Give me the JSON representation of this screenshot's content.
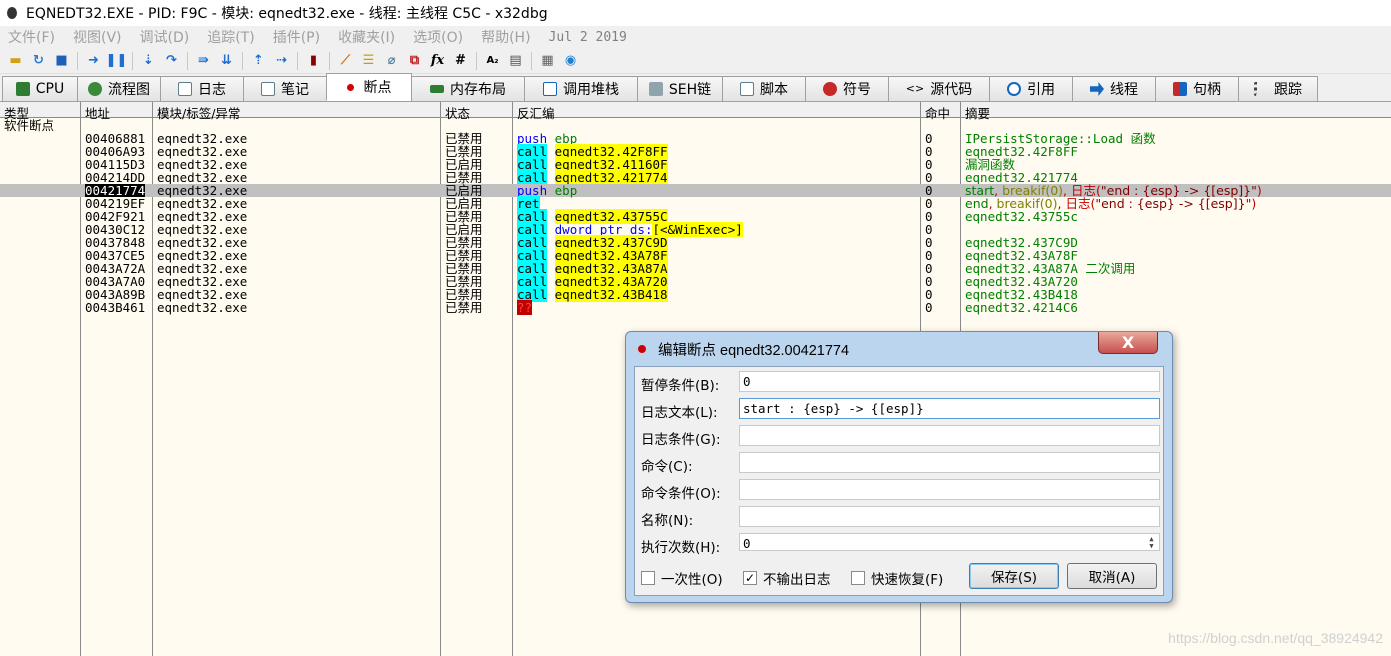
{
  "window": {
    "title": "EQNEDT32.EXE - PID: F9C - 模块: eqnedt32.exe - 线程: 主线程 C5C - x32dbg"
  },
  "menu": {
    "items": [
      "文件(F)",
      "视图(V)",
      "调试(D)",
      "追踪(T)",
      "插件(P)",
      "收藏夹(I)",
      "选项(O)",
      "帮助(H)"
    ],
    "date": "Jul 2 2019"
  },
  "toolbar": {
    "icons": [
      "open-icon",
      "restart-icon",
      "stop-icon",
      "run-icon",
      "pause-icon",
      "step-into-icon",
      "step-over-icon",
      "trace-into-icon",
      "trace-over-icon",
      "execute-till-return-icon",
      "run-to-user-code-icon",
      "script-icon",
      "patch-icon",
      "comment-icon",
      "label-icon",
      "bookmark-icon",
      "function-icon",
      "hash-icon",
      "font-icon",
      "calculator-icon",
      "globe-icon"
    ],
    "glyphs": {
      "function": "fx",
      "hash": "#",
      "font": "A₂"
    }
  },
  "tabs": [
    {
      "label": "CPU",
      "icon": "cpu-icon",
      "color": "#2e7d32"
    },
    {
      "label": "流程图",
      "icon": "graph-icon",
      "color": "#3a8a3a"
    },
    {
      "label": "日志",
      "icon": "log-icon",
      "color": "#607d8b"
    },
    {
      "label": "笔记",
      "icon": "notes-icon",
      "color": "#607d8b"
    },
    {
      "label": "断点",
      "icon": "breakpoint-icon",
      "color": "#d50000"
    },
    {
      "label": "内存布局",
      "icon": "memory-icon",
      "color": "#2e7d32"
    },
    {
      "label": "调用堆栈",
      "icon": "callstack-icon",
      "color": "#1565c0"
    },
    {
      "label": "SEH链",
      "icon": "seh-icon",
      "color": "#455a64"
    },
    {
      "label": "脚本",
      "icon": "script-icon",
      "color": "#607d8b"
    },
    {
      "label": "符号",
      "icon": "symbols-icon",
      "color": "#c62828"
    },
    {
      "label": "源代码",
      "icon": "source-icon",
      "color": "#424242"
    },
    {
      "label": "引用",
      "icon": "references-icon",
      "color": "#1565c0"
    },
    {
      "label": "线程",
      "icon": "threads-icon",
      "color": "#1565c0"
    },
    {
      "label": "句柄",
      "icon": "handles-icon",
      "color": "#c62828"
    },
    {
      "label": "跟踪",
      "icon": "trace-icon",
      "color": "#424242"
    }
  ],
  "active_tab": "断点",
  "columns": {
    "type": "类型",
    "address": "地址",
    "module": "模块/标签/异常",
    "state": "状态",
    "disasm": "反汇编",
    "hits": "命中",
    "summary": "摘要"
  },
  "group_label": "软件断点",
  "rows": [
    {
      "address": "00406881",
      "module": "eqnedt32.exe",
      "state": "已禁用",
      "disasm": [
        "push",
        "ebp",
        ""
      ],
      "hits": "0",
      "summary": "IPersistStorage::Load 函数"
    },
    {
      "address": "00406A93",
      "module": "eqnedt32.exe",
      "state": "已禁用",
      "disasm": [
        "call",
        "eqnedt32.42F8FF",
        ""
      ],
      "hits": "0",
      "summary": "eqnedt32.42F8FF"
    },
    {
      "address": "004115D3",
      "module": "eqnedt32.exe",
      "state": "已启用",
      "disasm": [
        "call",
        "eqnedt32.41160F",
        ""
      ],
      "hits": "0",
      "summary": "漏洞函数"
    },
    {
      "address": "004214DD",
      "module": "eqnedt32.exe",
      "state": "已禁用",
      "disasm": [
        "call",
        "eqnedt32.421774",
        ""
      ],
      "hits": "0",
      "summary": "eqnedt32.421774"
    },
    {
      "address": "00421774",
      "module": "eqnedt32.exe",
      "state": "已启用",
      "disasm": [
        "push",
        "ebp",
        ""
      ],
      "hits": "0",
      "summary": "start, breakif(0), 日志(\"end : {esp} -> {[esp]}\")"
    },
    {
      "address": "004219EF",
      "module": "eqnedt32.exe",
      "state": "已启用",
      "disasm": [
        "ret",
        "",
        ""
      ],
      "hits": "0",
      "summary": "end, breakif(0), 日志(\"end : {esp} -> {[esp]}\")"
    },
    {
      "address": "0042F921",
      "module": "eqnedt32.exe",
      "state": "已禁用",
      "disasm": [
        "call",
        "eqnedt32.43755C",
        ""
      ],
      "hits": "0",
      "summary": "eqnedt32.43755c"
    },
    {
      "address": "00430C12",
      "module": "eqnedt32.exe",
      "state": "已启用",
      "disasm": [
        "call",
        "dword ptr ds:",
        "[<&WinExec>]"
      ],
      "hits": "0",
      "summary": ""
    },
    {
      "address": "00437848",
      "module": "eqnedt32.exe",
      "state": "已禁用",
      "disasm": [
        "call",
        "eqnedt32.437C9D",
        ""
      ],
      "hits": "0",
      "summary": "eqnedt32.437C9D"
    },
    {
      "address": "00437CE5",
      "module": "eqnedt32.exe",
      "state": "已禁用",
      "disasm": [
        "call",
        "eqnedt32.43A78F",
        ""
      ],
      "hits": "0",
      "summary": "eqnedt32.43A78F"
    },
    {
      "address": "0043A72A",
      "module": "eqnedt32.exe",
      "state": "已禁用",
      "disasm": [
        "call",
        "eqnedt32.43A87A",
        ""
      ],
      "hits": "0",
      "summary": "eqnedt32.43A87A 二次调用"
    },
    {
      "address": "0043A7A0",
      "module": "eqnedt32.exe",
      "state": "已禁用",
      "disasm": [
        "call",
        "eqnedt32.43A720",
        ""
      ],
      "hits": "0",
      "summary": "eqnedt32.43A720"
    },
    {
      "address": "0043A89B",
      "module": "eqnedt32.exe",
      "state": "已禁用",
      "disasm": [
        "call",
        "eqnedt32.43B418",
        ""
      ],
      "hits": "0",
      "summary": "eqnedt32.43B418"
    },
    {
      "address": "0043B461",
      "module": "eqnedt32.exe",
      "state": "已禁用",
      "disasm": [
        "??",
        "",
        ""
      ],
      "hits": "0",
      "summary": "eqnedt32.4214C6"
    }
  ],
  "selected_row": 4,
  "dialog": {
    "title": "编辑断点 eqnedt32.00421774",
    "close": "X",
    "fields": [
      {
        "label": "暂停条件(B):",
        "value": ""
      },
      {
        "label": "日志文本(L):",
        "value": "start : {esp} -> {[esp]}"
      },
      {
        "label": "日志条件(G):",
        "value": ""
      },
      {
        "label": "命令(C):",
        "value": ""
      },
      {
        "label": "命令条件(O):",
        "value": ""
      },
      {
        "label": "名称(N):",
        "value": ""
      },
      {
        "label": "执行次数(H):",
        "value": "0"
      }
    ],
    "pause_value": "0",
    "spinner": {
      "up": "▲",
      "down": "▼"
    },
    "checkboxes": [
      {
        "label": "一次性(O)",
        "checked": false
      },
      {
        "label": "不输出日志",
        "checked": true
      },
      {
        "label": "快速恢复(F)",
        "checked": false
      }
    ],
    "check_mark": "✓",
    "save": "保存(S)",
    "cancel": "取消(A)"
  },
  "watermark": "https://blog.csdn.net/qq_38924942"
}
